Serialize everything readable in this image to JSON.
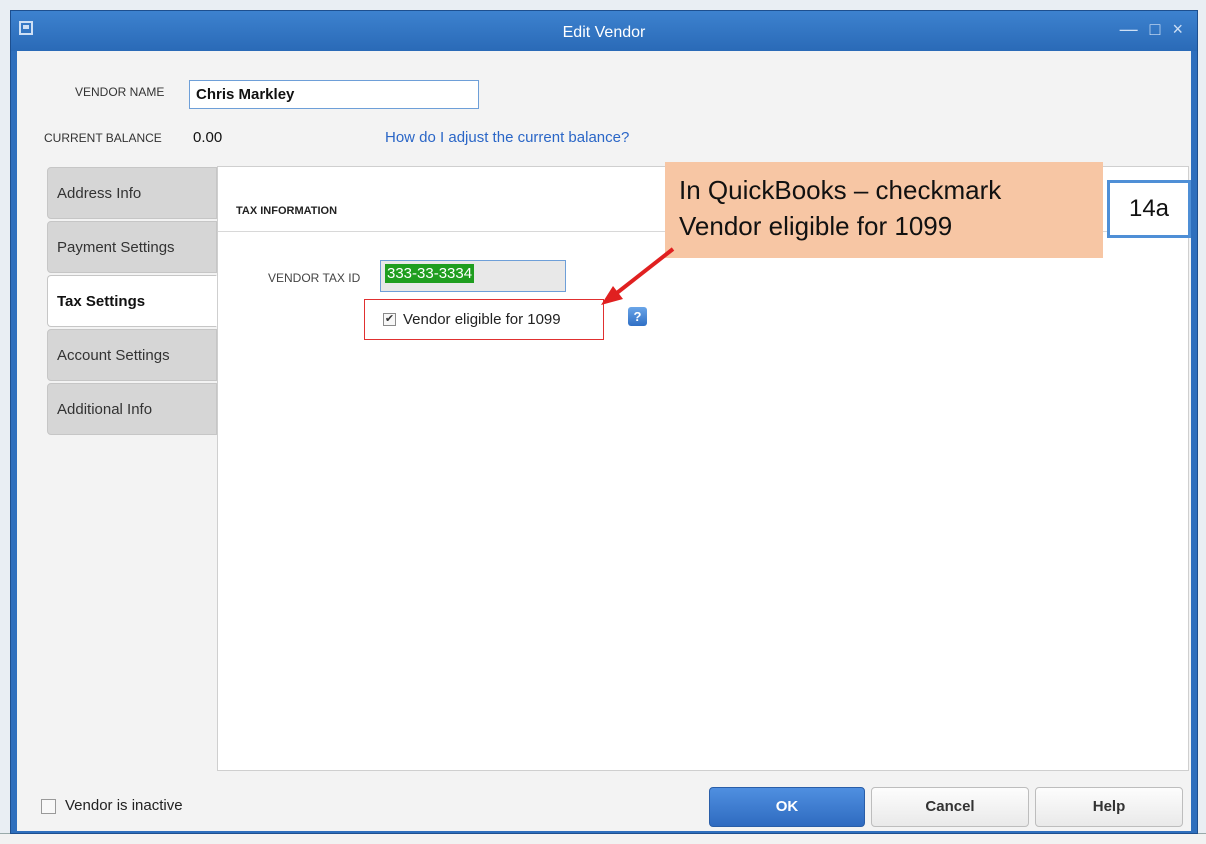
{
  "window": {
    "title": "Edit Vendor"
  },
  "vendor": {
    "name_label": "VENDOR NAME",
    "name_value": "Chris Markley",
    "balance_label": "CURRENT BALANCE",
    "balance_value": "0.00",
    "adjust_link": "How do I adjust the current balance?"
  },
  "tabs": [
    {
      "label": "Address Info",
      "active": false
    },
    {
      "label": "Payment Settings",
      "active": false
    },
    {
      "label": "Tax Settings",
      "active": true
    },
    {
      "label": "Account Settings",
      "active": false
    },
    {
      "label": "Additional Info",
      "active": false
    }
  ],
  "tax": {
    "section_title": "TAX INFORMATION",
    "tax_id_label": "VENDOR TAX ID",
    "tax_id_value": "333-33-3334",
    "eligible_label": "Vendor eligible for 1099",
    "eligible_checked": true,
    "help_glyph": "?"
  },
  "annotation": {
    "callout_line1": "In QuickBooks – checkmark",
    "callout_line2": "Vendor eligible for 1099",
    "ref": "14a"
  },
  "footer": {
    "inactive_label": "Vendor is inactive",
    "ok": "OK",
    "cancel": "Cancel",
    "help": "Help"
  },
  "colors": {
    "title_bar": "#2e6fbd",
    "accent": "#2a66c7",
    "highlight": "#1f9e1f",
    "callout": "#f7c6a4",
    "arrow": "#e02020"
  }
}
